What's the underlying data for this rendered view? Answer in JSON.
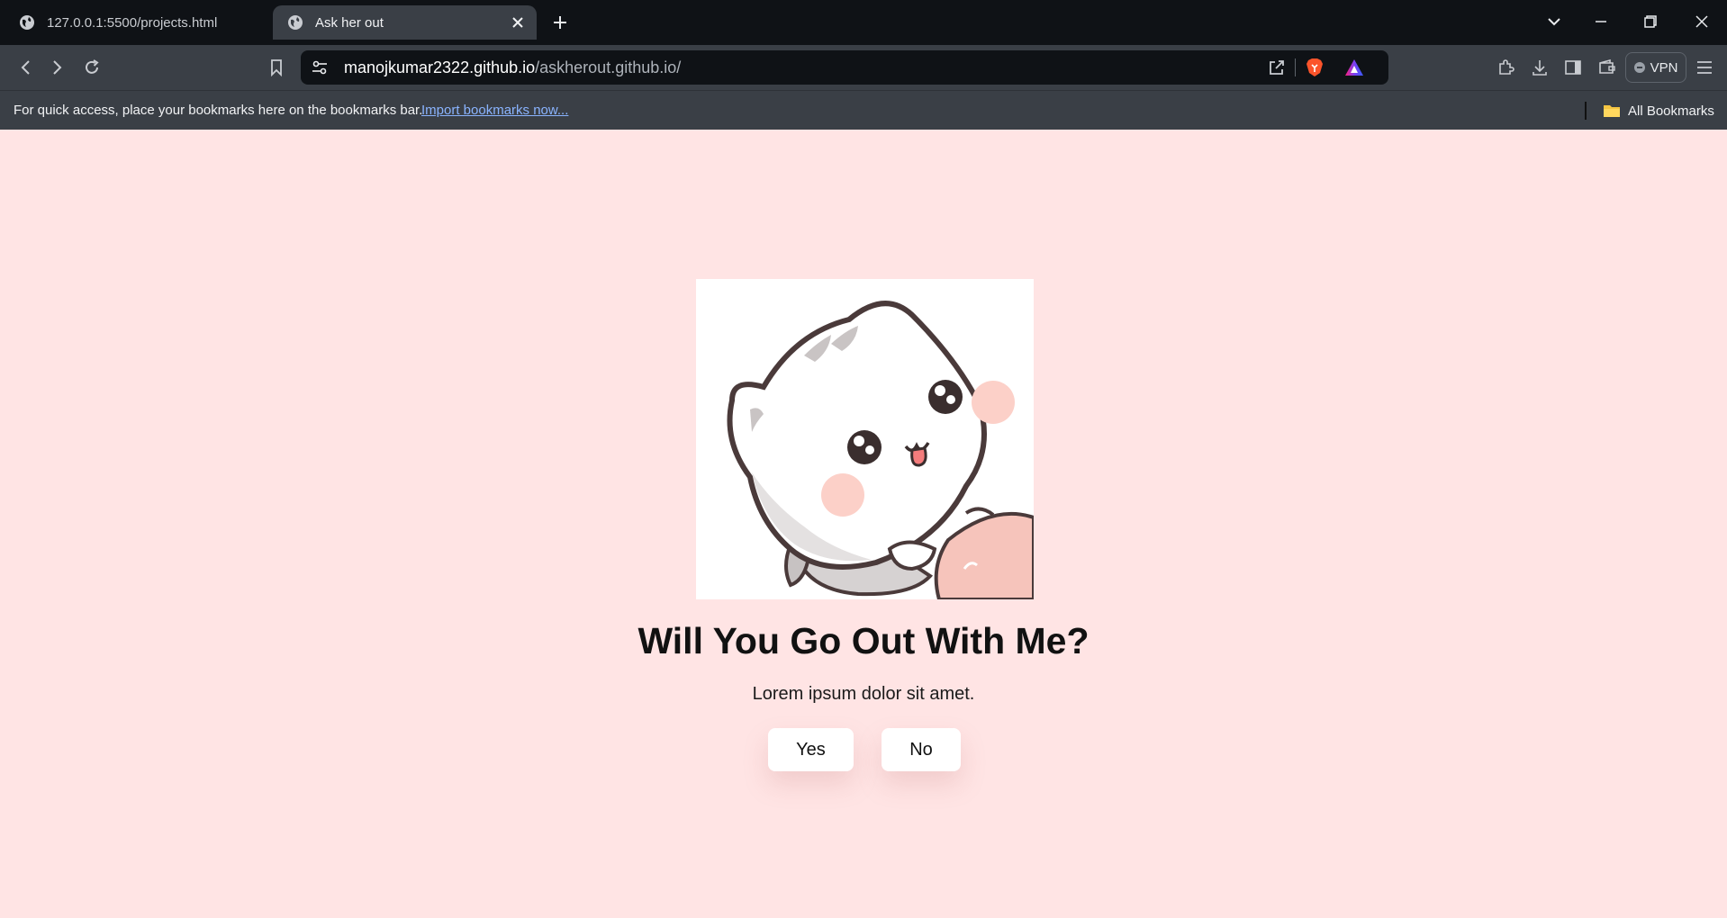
{
  "browser": {
    "tabs": [
      {
        "title": "127.0.0.1:5500/projects.html",
        "active": false
      },
      {
        "title": "Ask her out",
        "active": true
      }
    ],
    "address": {
      "host": "manojkumar2322.github.io",
      "path": "/askherout.github.io/"
    },
    "vpn_label": "VPN",
    "bookmarks_bar": {
      "hint": "For quick access, place your bookmarks here on the bookmarks bar.",
      "import_link": "Import bookmarks now...",
      "all_bookmarks": "All Bookmarks"
    },
    "icons": [
      "globe-icon",
      "close-icon",
      "plus-icon",
      "chevron-down-icon",
      "minimize-icon",
      "restore-icon",
      "back-icon",
      "forward-icon",
      "reload-icon",
      "bookmark-icon",
      "site-settings-icon",
      "share-icon",
      "brave-shields-icon",
      "brave-rewards-icon",
      "extensions-icon",
      "download-icon",
      "sidebar-icon",
      "wallet-icon",
      "menu-icon",
      "folder-icon"
    ],
    "colors": {
      "tabstrip": "#0f1216",
      "toolbar": "#3a3f46",
      "link": "#8ab4ff"
    }
  },
  "page": {
    "image": "cute-cat-sticker",
    "headline": "Will You Go Out With Me?",
    "subtext": "Lorem ipsum dolor sit amet.",
    "yes_label": "Yes",
    "no_label": "No",
    "colors": {
      "background": "#ffe4e4",
      "button": "#ffffff",
      "blush": "#fcd0c8"
    }
  }
}
